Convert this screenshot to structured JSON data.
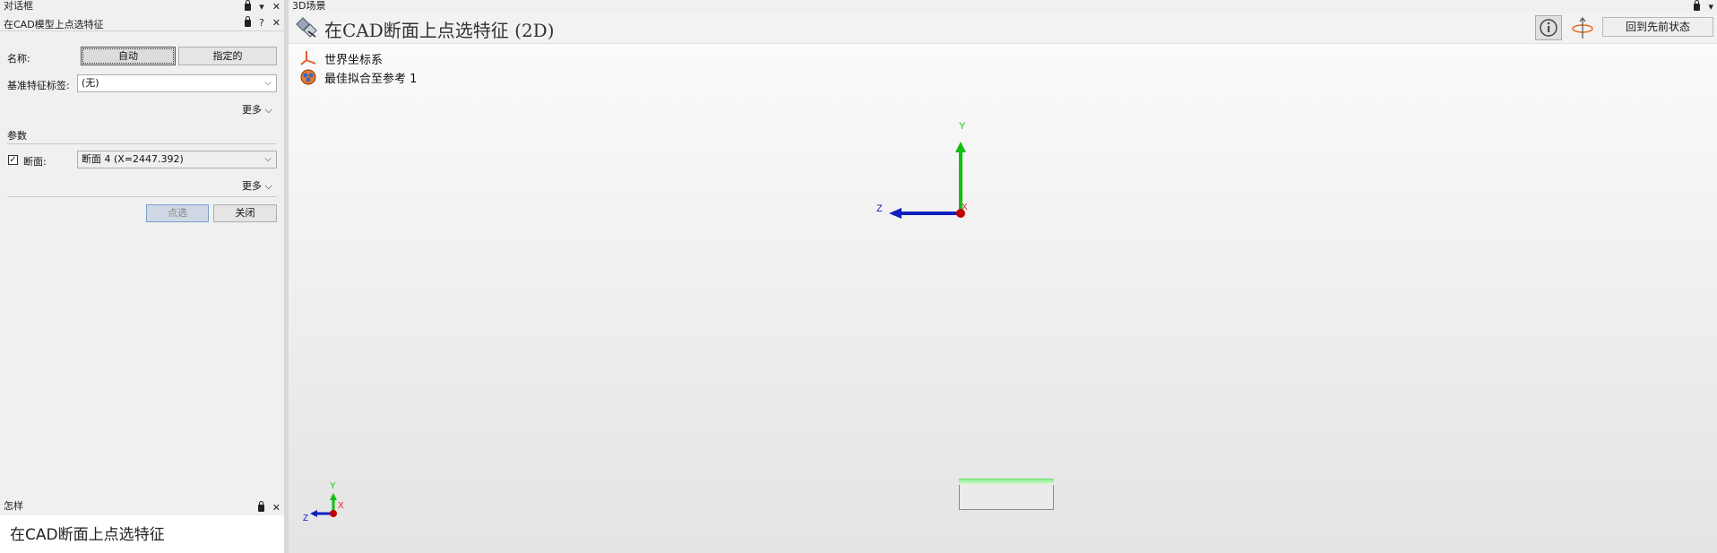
{
  "dialog": {
    "panel_title": "对话框",
    "sub_title": "在CAD模型上点选特征",
    "name_label": "名称:",
    "name_mode_auto": "自动",
    "name_mode_specified": "指定的",
    "datum_label": "基准特征标签:",
    "datum_value": "(无)",
    "more_label_1": "更多",
    "params_heading": "参数",
    "section_checked": true,
    "section_label": "断面:",
    "section_value": "断面 4 (X=2447.392)",
    "more_label_2": "更多",
    "pick_button": "点选",
    "close_button": "关闭"
  },
  "help_panel": {
    "title": "怎样",
    "body_text": "在CAD断面上点选特征"
  },
  "scene": {
    "panel_title": "3D场景",
    "heading": "在CAD断面上点选特征 (2D)",
    "reset_button": "回到先前状态",
    "tree": [
      {
        "label": "世界坐标系",
        "icon": "coordinate-system-icon"
      },
      {
        "label": "最佳拟合至参考 1",
        "icon": "best-fit-icon"
      }
    ],
    "axes_main": {
      "x": "X",
      "y": "Y",
      "z": "Z"
    },
    "axes_mini": {
      "x": "X",
      "y": "Y",
      "z": "Z"
    }
  },
  "colors": {
    "axis_x": "#e02020",
    "axis_y": "#10c010",
    "axis_z": "#1020c0",
    "origin": "#c00000"
  }
}
